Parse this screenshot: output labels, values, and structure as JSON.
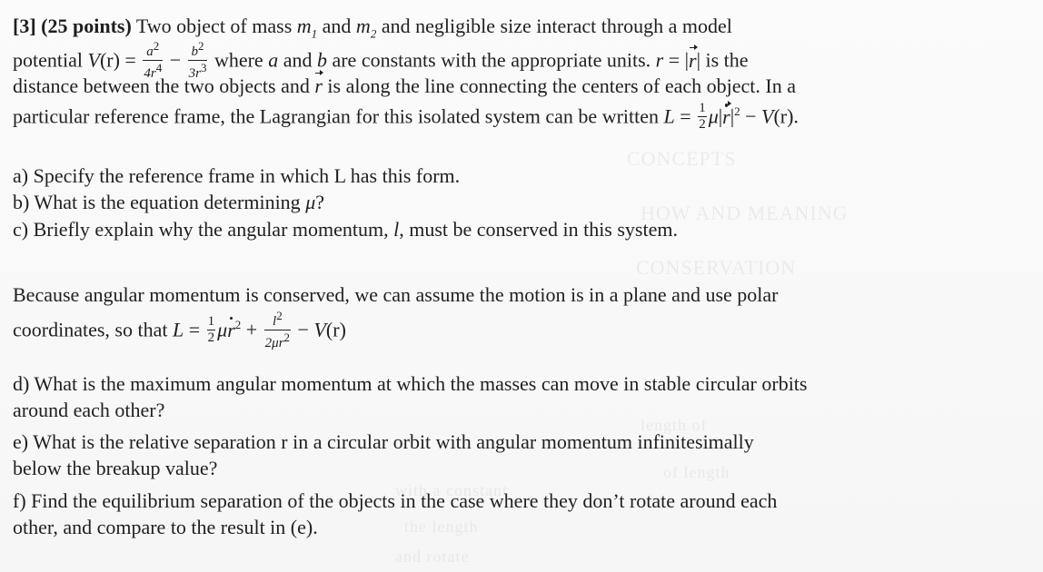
{
  "problem": {
    "number": "[3]",
    "points": "(25 points)",
    "intro": {
      "l1": "Two object of mass ",
      "m1": "m",
      "m1_sub": "1",
      "and": " and ",
      "m2": "m",
      "m2_sub": "2",
      "l1_end": " and negligible size interact through a model",
      "l2_a": "potential ",
      "l2_b": "where ",
      "a": "a",
      "l2_c": " and ",
      "b": "b",
      "l2_d": " are constants with the appropriate units. ",
      "r": "r",
      "eq": " = |",
      "rvec": "r",
      "bar_end": "| is the",
      "l3_a": "distance between the two objects and ",
      "l3_b": " is along the line connecting the centers of each object. In a",
      "l4_a": "particular reference frame, the Lagrangian for this isolated system can be written ",
      "l4_L": "L",
      "l4_eq": " = ",
      "l4_rest": " − ",
      "l4_V": "V",
      "l4_end": "(r)."
    },
    "potential": {
      "V": "V",
      "r": "(r)",
      "eq": " = ",
      "frac1_num": "a",
      "frac1_num_sup": "2",
      "frac1_den": "4r",
      "frac1_den_sup": "4",
      "minus": " − ",
      "frac2_num": "b",
      "frac2_num_sup": "2",
      "frac2_den": "3r",
      "frac2_den_sup": "3"
    },
    "lagr1": {
      "half_num": "1",
      "half_den": "2",
      "mu": "μ",
      "abs_open": "|",
      "abs_close": "|",
      "sq": "2"
    },
    "parts": {
      "a": "a) Specify the reference frame in which L has this form.",
      "b_prefix": "b) What is the equation determining ",
      "b_mu": "μ",
      "b_suffix": "?",
      "c_prefix": "c) Briefly explain why the angular momentum, ",
      "c_l": "l",
      "c_suffix": ", must be conserved in this system.",
      "d_l1": "d) What is the maximum angular momentum at which the masses can move in stable circular orbits",
      "d_l2": "around each other?",
      "e_l1": "e) What is the relative separation r in a circular orbit with angular momentum infinitesimally",
      "e_l2": "below the breakup value?",
      "f_l1": "f) Find the equilibrium separation of the objects in the case where they don’t rotate around each",
      "f_l2": "other, and compare to the result in (e)."
    },
    "polar": {
      "l1": "Because angular momentum is conserved, we can assume the motion is in a plane and use polar",
      "l2_a": "coordinates, so that ",
      "L": "L",
      "eq": " = ",
      "half_num": "1",
      "half_den": "2",
      "mu": "μ",
      "rdot": "r",
      "sq": "2",
      "plus": " + ",
      "frac_num": "l",
      "frac_num_sup": "2",
      "frac_den": "2μr",
      "frac_den_sup": "2",
      "minus": " − ",
      "V": "V",
      "arg": "(r)"
    }
  },
  "ghost_text": {
    "g1": "CONCEPTS",
    "g2": "HOW AND MEANING",
    "g3": "CONSERVATION",
    "g4": "length of",
    "g5": "of length",
    "g6": "with a constant",
    "g7": "the length",
    "g8": "and rotate"
  }
}
